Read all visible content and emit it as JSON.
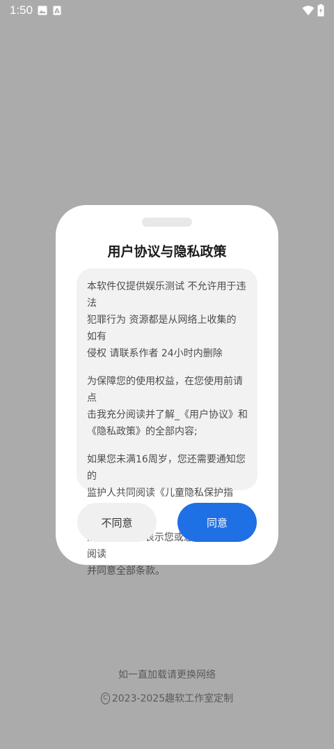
{
  "status_bar": {
    "time": "1:50",
    "icons": [
      "gallery-icon",
      "a-notification-icon",
      "wifi-icon",
      "battery-charging-icon"
    ]
  },
  "dialog": {
    "title": "用户协议与隐私政策",
    "paragraphs": [
      "本软件仅提供娱乐测试 不允许用于违法\n犯罪行为 资源都是从网络上收集的 如有\n侵权 请联系作者 24小时内删除",
      " 为保障您的使用权益，在您使用前请点\n击我充分阅读并了解_《用户协议》和\n《隐私政策》的全部内容;",
      "如果您未满16周岁，您还需要通知您的\n监护人共同阅读《儿童隐私保护指引》；",
      "点击\"同意\"即表示您或您的监护人已阅读\n并同意全部条款。"
    ],
    "disagree_label": "不同意",
    "agree_label": "同意"
  },
  "footer": {
    "hint": "如一直加载请更换网络",
    "copyright_symbol": "C",
    "copyright": "2023-2025趣软工作室定制"
  },
  "colors": {
    "background": "#ababab",
    "agree_button": "#1f6fe5",
    "disagree_button": "#f0f0f0",
    "content_box": "#f2f2f2"
  }
}
